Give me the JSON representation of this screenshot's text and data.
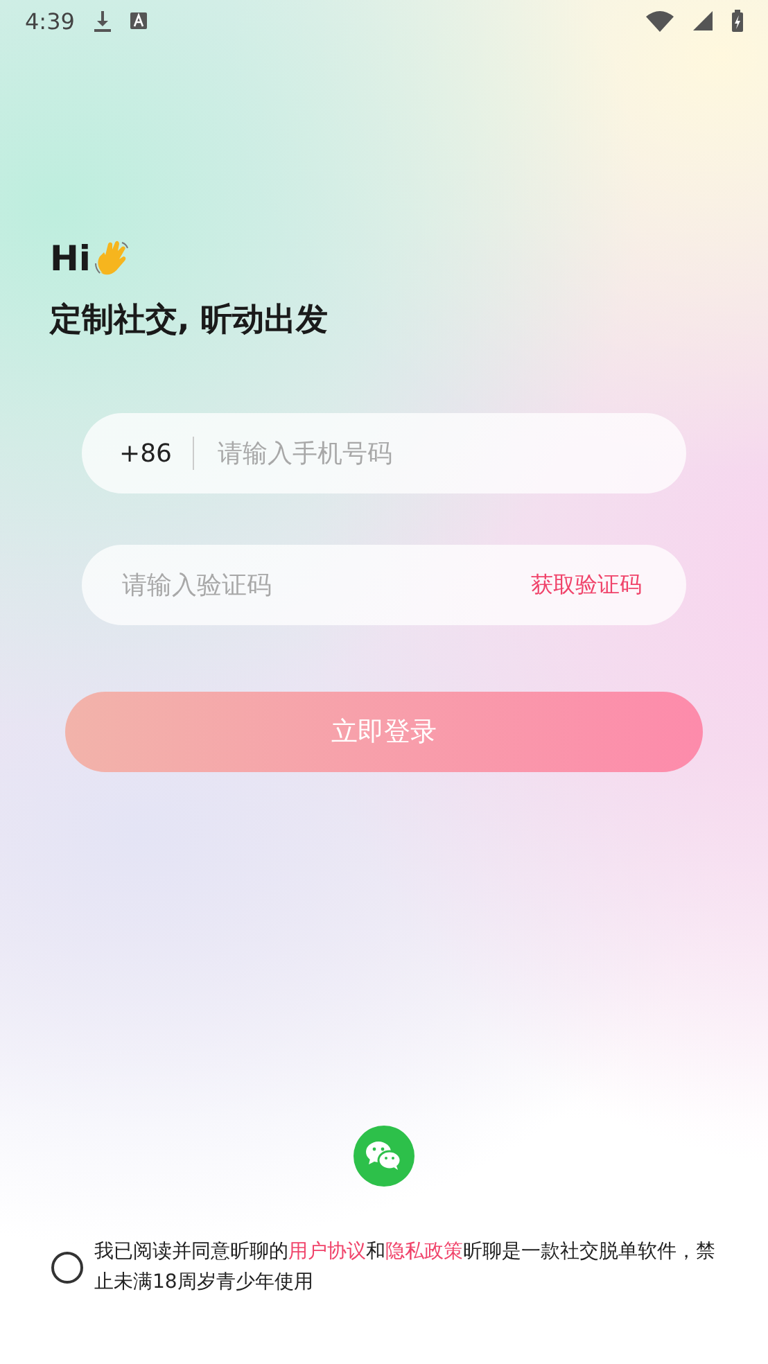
{
  "status_bar": {
    "time": "4:39"
  },
  "greeting": {
    "title": "Hi",
    "subtitle": "定制社交, 昕动出发"
  },
  "phone_field": {
    "country_code": "+86",
    "placeholder": "请输入手机号码"
  },
  "code_field": {
    "placeholder": "请输入验证码",
    "action": "获取验证码"
  },
  "login_button": {
    "label": "立即登录"
  },
  "agreement": {
    "checked": false,
    "parts": [
      {
        "kind": "text",
        "text": "我已阅读并同意昕聊的"
      },
      {
        "kind": "link",
        "text": "用户协议"
      },
      {
        "kind": "text",
        "text": "和"
      },
      {
        "kind": "link",
        "text": "隐私政策"
      },
      {
        "kind": "text",
        "text": "昕聊是一款社交脱单软件，禁止未满18周岁青少年使用"
      }
    ]
  }
}
